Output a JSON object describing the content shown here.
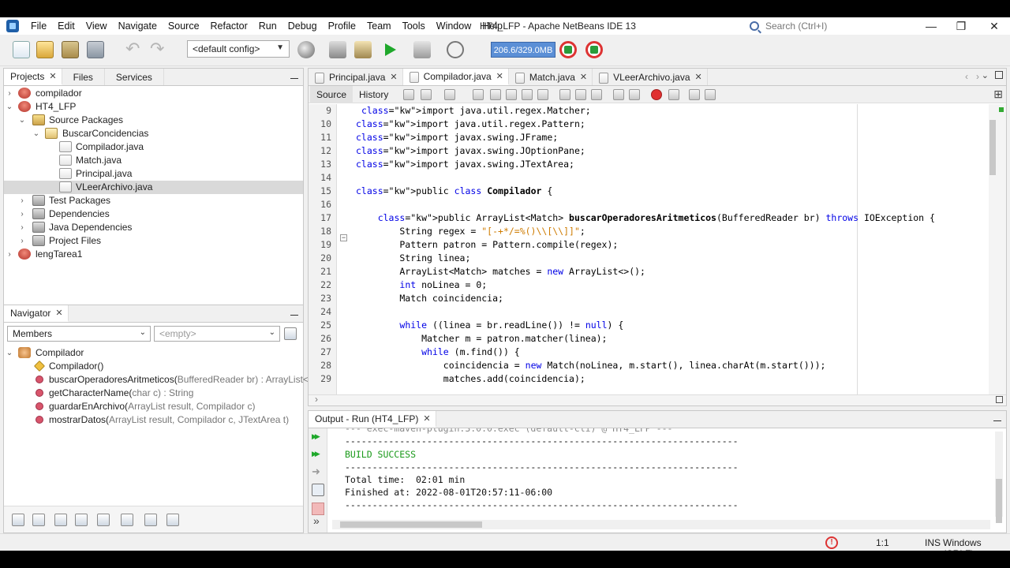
{
  "window": {
    "title": "HT4_LFP - Apache NetBeans IDE 13",
    "search_placeholder": "Search (Ctrl+I)"
  },
  "menu": [
    "File",
    "Edit",
    "View",
    "Navigate",
    "Source",
    "Refactor",
    "Run",
    "Debug",
    "Profile",
    "Team",
    "Tools",
    "Window",
    "Help"
  ],
  "toolbar": {
    "config": "<default config>",
    "memory": "206.6/329.0MB"
  },
  "projects_panel": {
    "tabs": [
      "Projects",
      "Files",
      "Services"
    ],
    "tree": [
      {
        "label": "compilador"
      },
      {
        "label": "HT4_LFP"
      },
      {
        "label": "Source Packages"
      },
      {
        "label": "BuscarConcidencias"
      },
      {
        "label": "Compilador.java"
      },
      {
        "label": "Match.java"
      },
      {
        "label": "Principal.java"
      },
      {
        "label": "VLeerArchivo.java"
      },
      {
        "label": "Test Packages"
      },
      {
        "label": "Dependencies"
      },
      {
        "label": "Java Dependencies"
      },
      {
        "label": "Project Files"
      },
      {
        "label": "lengTarea1"
      }
    ]
  },
  "navigator": {
    "tab": "Navigator",
    "filter": "Members",
    "empty": "<empty>",
    "class_name": "Compilador",
    "members": [
      {
        "name": "Compilador()",
        "sig": ""
      },
      {
        "name": "buscarOperadoresAritmeticos(",
        "sig": "BufferedReader br) : ArrayList<Mat"
      },
      {
        "name": "getCharacterName(",
        "sig": "char c) : String"
      },
      {
        "name": "guardarEnArchivo(",
        "sig": "ArrayList result, Compilador c)"
      },
      {
        "name": "mostrarDatos(",
        "sig": "ArrayList result, Compilador c, JTextArea t)"
      }
    ]
  },
  "editor": {
    "tabs": [
      "Principal.java",
      "Compilador.java",
      "Match.java",
      "VLeerArchivo.java"
    ],
    "source_tab": "Source",
    "history_tab": "History",
    "line_numbers": [
      "9",
      "10",
      "11",
      "12",
      "13",
      "14",
      "15",
      "16",
      "17",
      "18",
      "19",
      "20",
      "21",
      "22",
      "23",
      "24",
      "25",
      "26",
      "27",
      "28",
      "29"
    ],
    "lines": [
      "import java.util.regex.Matcher;",
      "import java.util.regex.Pattern;",
      "import javax.swing.JFrame;",
      "import javax.swing.JOptionPane;",
      "import javax.swing.JTextArea;",
      "",
      "public class Compilador {",
      "",
      "    public ArrayList<Match> buscarOperadoresAritmeticos(BufferedReader br) throws IOException {",
      "        String regex = \"[-+*/=%()\\\\[\\\\]]\";",
      "        Pattern patron = Pattern.compile(regex);",
      "        String linea;",
      "        ArrayList<Match> matches = new ArrayList<>();",
      "        int noLinea = 0;",
      "        Match coincidencia;",
      "",
      "        while ((linea = br.readLine()) != null) {",
      "            Matcher m = patron.matcher(linea);",
      "            while (m.find()) {",
      "                coincidencia = new Match(noLinea, m.start(), linea.charAt(m.start()));",
      "                matches.add(coincidencia);"
    ]
  },
  "output": {
    "tab": "Output - Run (HT4_LFP)",
    "lines": [
      "--- exec-maven-plugin:3.0.0:exec (default-cli) @ HT4_LFP ---",
      "------------------------------------------------------------------------",
      "BUILD SUCCESS",
      "------------------------------------------------------------------------",
      "Total time:  02:01 min",
      "Finished at: 2022-08-01T20:57:11-06:00",
      "------------------------------------------------------------------------"
    ]
  },
  "status": {
    "position": "1:1",
    "mode": "INS",
    "line_ending": "Windows (CRLF)"
  }
}
